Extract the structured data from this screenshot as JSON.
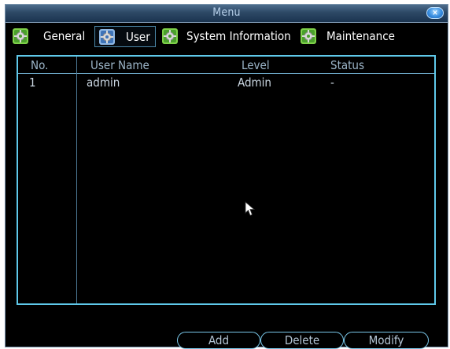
{
  "window": {
    "title": "Menu",
    "close_icon": "close-icon",
    "close_glyph": "×"
  },
  "tabs": [
    {
      "label": "General",
      "icon": "settings-gear-icon",
      "active": false
    },
    {
      "label": "User",
      "icon": "settings-gear-icon",
      "active": true
    },
    {
      "label": "System Information",
      "icon": "settings-gear-icon",
      "active": false
    },
    {
      "label": "Maintenance",
      "icon": "settings-gear-icon",
      "active": false
    }
  ],
  "table": {
    "columns": [
      "No.",
      "User Name",
      "Level",
      "Status"
    ],
    "rows": [
      {
        "no": "1",
        "user_name": "admin",
        "level": "Admin",
        "status": "-"
      }
    ]
  },
  "buttons": {
    "add": "Add",
    "delete": "Delete",
    "modify": "Modify"
  },
  "colors": {
    "accent": "#5fc9ea",
    "title_bar": "#2d4865",
    "background": "#000000"
  }
}
